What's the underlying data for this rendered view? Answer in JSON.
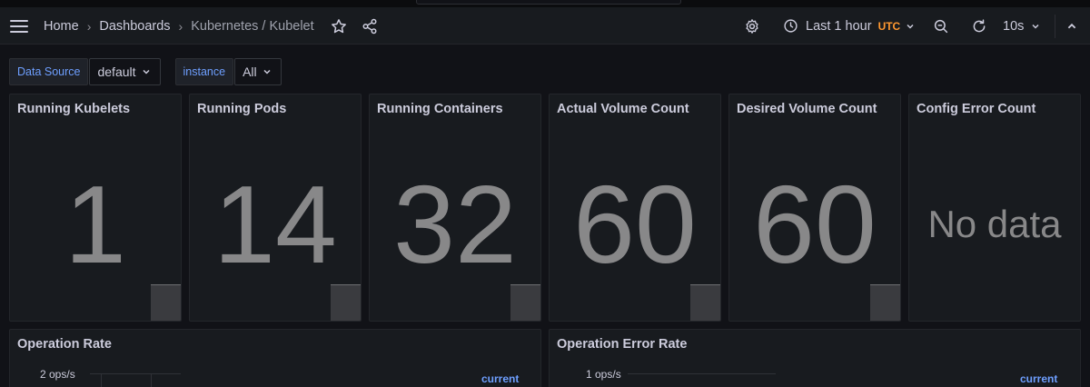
{
  "navbar": {
    "breadcrumbs": [
      "Home",
      "Dashboards",
      "Kubernetes / Kubelet"
    ],
    "separator": "›",
    "time_range": "Last 1 hour",
    "timezone": "UTC",
    "refresh_interval": "10s"
  },
  "variables": [
    {
      "label": "Data Source",
      "value": "default"
    },
    {
      "label": "instance",
      "value": "All"
    }
  ],
  "stat_panels": [
    {
      "title": "Running Kubelets",
      "value": "1"
    },
    {
      "title": "Running Pods",
      "value": "14"
    },
    {
      "title": "Running Containers",
      "value": "32"
    },
    {
      "title": "Actual Volume Count",
      "value": "60"
    },
    {
      "title": "Desired Volume Count",
      "value": "60"
    },
    {
      "title": "Config Error Count",
      "value": "No data"
    }
  ],
  "graph_panels": [
    {
      "title": "Operation Rate",
      "y_tick": "2 ops/s",
      "legend_header": "current"
    },
    {
      "title": "Operation Error Rate",
      "y_tick": "1 ops/s",
      "legend_header": "current"
    }
  ],
  "colors": {
    "accent": "#6e9fff",
    "timezone": "#ff9830",
    "stat_value": "#888889",
    "background": "#111217",
    "panel": "#181b1f"
  }
}
